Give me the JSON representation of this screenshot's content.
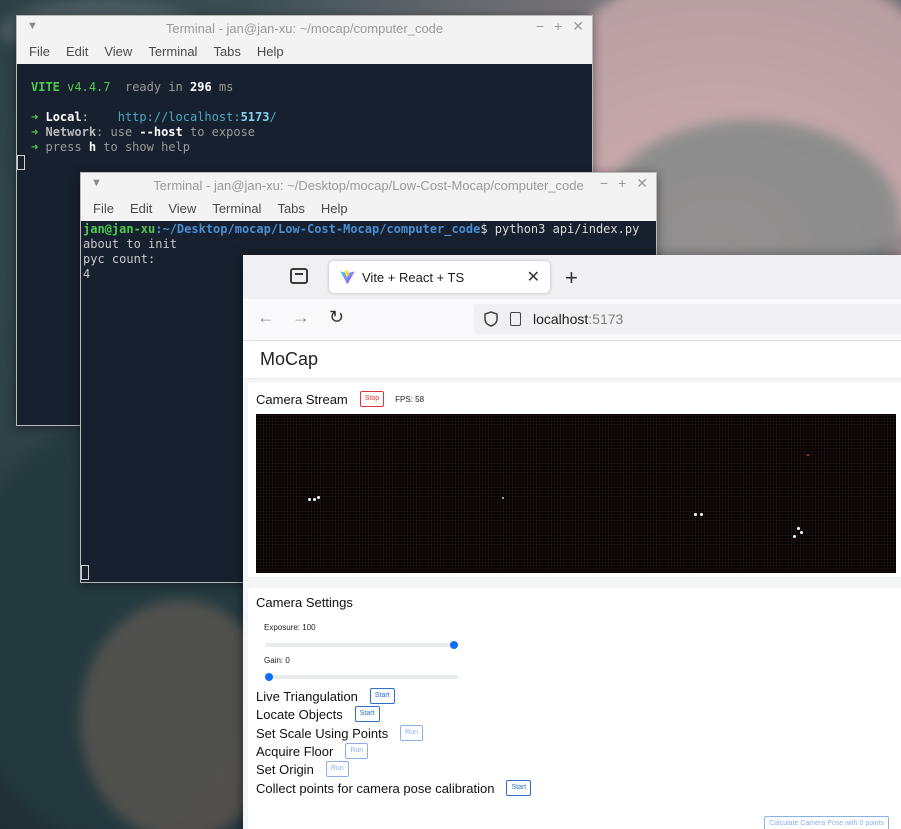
{
  "terminal1": {
    "title": "Terminal - jan@jan-xu: ~/mocap/computer_code",
    "menu": [
      "File",
      "Edit",
      "View",
      "Terminal",
      "Tabs",
      "Help"
    ],
    "vite_name": "VITE",
    "vite_version": "v4.4.7",
    "ready_text": "ready in",
    "ready_ms": "296",
    "ms": "ms",
    "local_arrow": "➜",
    "local_label": "Local",
    "local_url_pre": "http://localhost:",
    "local_port": "5173",
    "local_url_post": "/",
    "network_label": "Network",
    "network_text_a": ": use ",
    "network_flag": "--host",
    "network_text_b": " to expose",
    "help_a": "press ",
    "help_key": "h",
    "help_b": " to show help"
  },
  "terminal2": {
    "title": "Terminal - jan@jan-xu: ~/Desktop/mocap/Low-Cost-Mocap/computer_code",
    "menu": [
      "File",
      "Edit",
      "View",
      "Terminal",
      "Tabs",
      "Help"
    ],
    "prompt_user": "jan@jan-xu",
    "prompt_path": ":~/Desktop/mocap/Low-Cost-Mocap/computer_code",
    "prompt_cmd": "$ python3 api/index.py",
    "lines": [
      "about to init",
      "pyc count:",
      "4"
    ]
  },
  "browser": {
    "tab_title": "Vite + React + TS",
    "url_host": "localhost",
    "url_port": ":5173",
    "app_title": "MoCap",
    "stream": {
      "label": "Camera Stream",
      "stop_label": "Stop",
      "fps_text": "FPS: 58"
    },
    "settings": {
      "label": "Camera Settings",
      "exposure_label": "Exposure: 100",
      "exposure_value": 100,
      "gain_label": "Gain: 0",
      "gain_value": 0,
      "actions": [
        {
          "label": "Live Triangulation",
          "button": "Start"
        },
        {
          "label": "Locate Objects",
          "button": "Start"
        },
        {
          "label": "Set Scale Using Points",
          "button": "Run"
        },
        {
          "label": "Acquire Floor",
          "button": "Run"
        },
        {
          "label": "Set Origin",
          "button": "Run"
        },
        {
          "label": "Collect points for camera pose calibration",
          "button": "Start"
        }
      ],
      "calc_button": "Calculate Camera Pose with 0 points"
    }
  }
}
